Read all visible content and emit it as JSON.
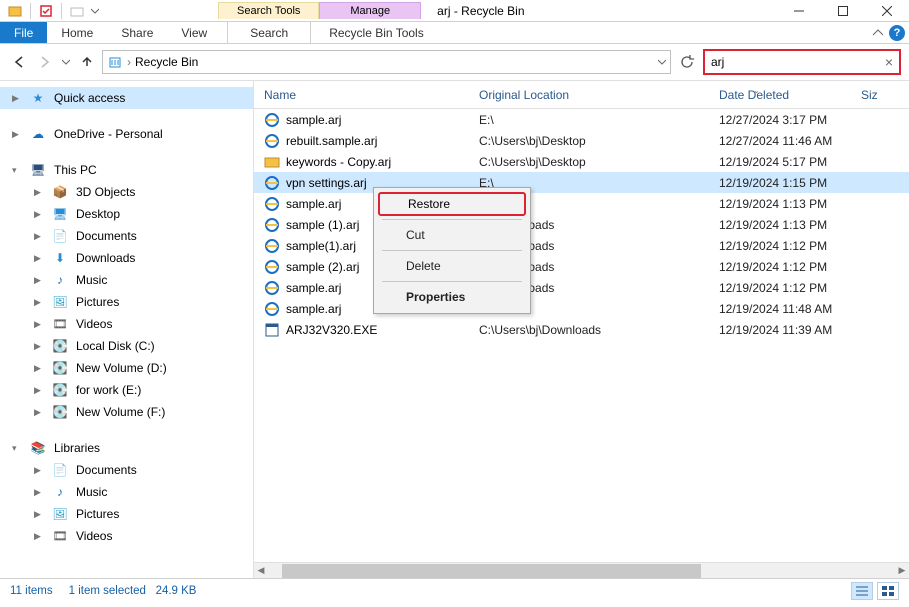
{
  "titlebar": {
    "title": "arj - Recycle Bin",
    "search_tools_label": "Search Tools",
    "manage_label": "Manage"
  },
  "ribbon": {
    "file": "File",
    "home": "Home",
    "share": "Share",
    "view": "View",
    "search": "Search",
    "recycle_tools": "Recycle Bin Tools"
  },
  "breadcrumb": {
    "label": "Recycle Bin"
  },
  "search": {
    "value": "arj"
  },
  "sidebar": {
    "quick_access": "Quick access",
    "onedrive": "OneDrive - Personal",
    "this_pc": "This PC",
    "pc_children": [
      "3D Objects",
      "Desktop",
      "Documents",
      "Downloads",
      "Music",
      "Pictures",
      "Videos",
      "Local Disk (C:)",
      "New Volume (D:)",
      "for work (E:)",
      "New Volume (F:)"
    ],
    "libraries": "Libraries",
    "lib_children": [
      "Documents",
      "Music",
      "Pictures",
      "Videos"
    ]
  },
  "columns": {
    "name": "Name",
    "orig": "Original Location",
    "date": "Date Deleted",
    "size": "Siz"
  },
  "files": [
    {
      "name": "sample.arj",
      "icon": "ie",
      "orig": "E:\\",
      "date": "12/27/2024 3:17 PM",
      "sel": false
    },
    {
      "name": "rebuilt.sample.arj",
      "icon": "ie",
      "orig": "C:\\Users\\bj\\Desktop",
      "date": "12/27/2024 11:46 AM",
      "sel": false
    },
    {
      "name": "keywords - Copy.arj",
      "icon": "folder",
      "orig": "C:\\Users\\bj\\Desktop",
      "date": "12/19/2024 5:17 PM",
      "sel": false
    },
    {
      "name": "vpn settings.arj",
      "icon": "ie",
      "orig": "E:\\",
      "date": "12/19/2024 1:15 PM",
      "sel": true
    },
    {
      "name": "sample.arj",
      "icon": "ie",
      "orig": "",
      "date": "12/19/2024 1:13 PM",
      "sel": false
    },
    {
      "name": "sample (1).arj",
      "icon": "ie",
      "orig": "\\bj\\Downloads",
      "date": "12/19/2024 1:13 PM",
      "sel": false
    },
    {
      "name": "sample(1).arj",
      "icon": "ie",
      "orig": "\\bj\\Downloads",
      "date": "12/19/2024 1:12 PM",
      "sel": false
    },
    {
      "name": "sample (2).arj",
      "icon": "ie",
      "orig": "\\bj\\Downloads",
      "date": "12/19/2024 1:12 PM",
      "sel": false
    },
    {
      "name": "sample.arj",
      "icon": "ie",
      "orig": "\\bj\\Downloads",
      "date": "12/19/2024 1:12 PM",
      "sel": false
    },
    {
      "name": "sample.arj",
      "icon": "ie",
      "orig": "E:\\",
      "date": "12/19/2024 11:48 AM",
      "sel": false
    },
    {
      "name": "ARJ32V320.EXE",
      "icon": "exe",
      "orig": "C:\\Users\\bj\\Downloads",
      "date": "12/19/2024 11:39 AM",
      "sel": false
    }
  ],
  "context_menu": {
    "restore": "Restore",
    "cut": "Cut",
    "delete": "Delete",
    "properties": "Properties"
  },
  "status": {
    "count": "11 items",
    "selection": "1 item selected",
    "size": "24.9 KB"
  }
}
